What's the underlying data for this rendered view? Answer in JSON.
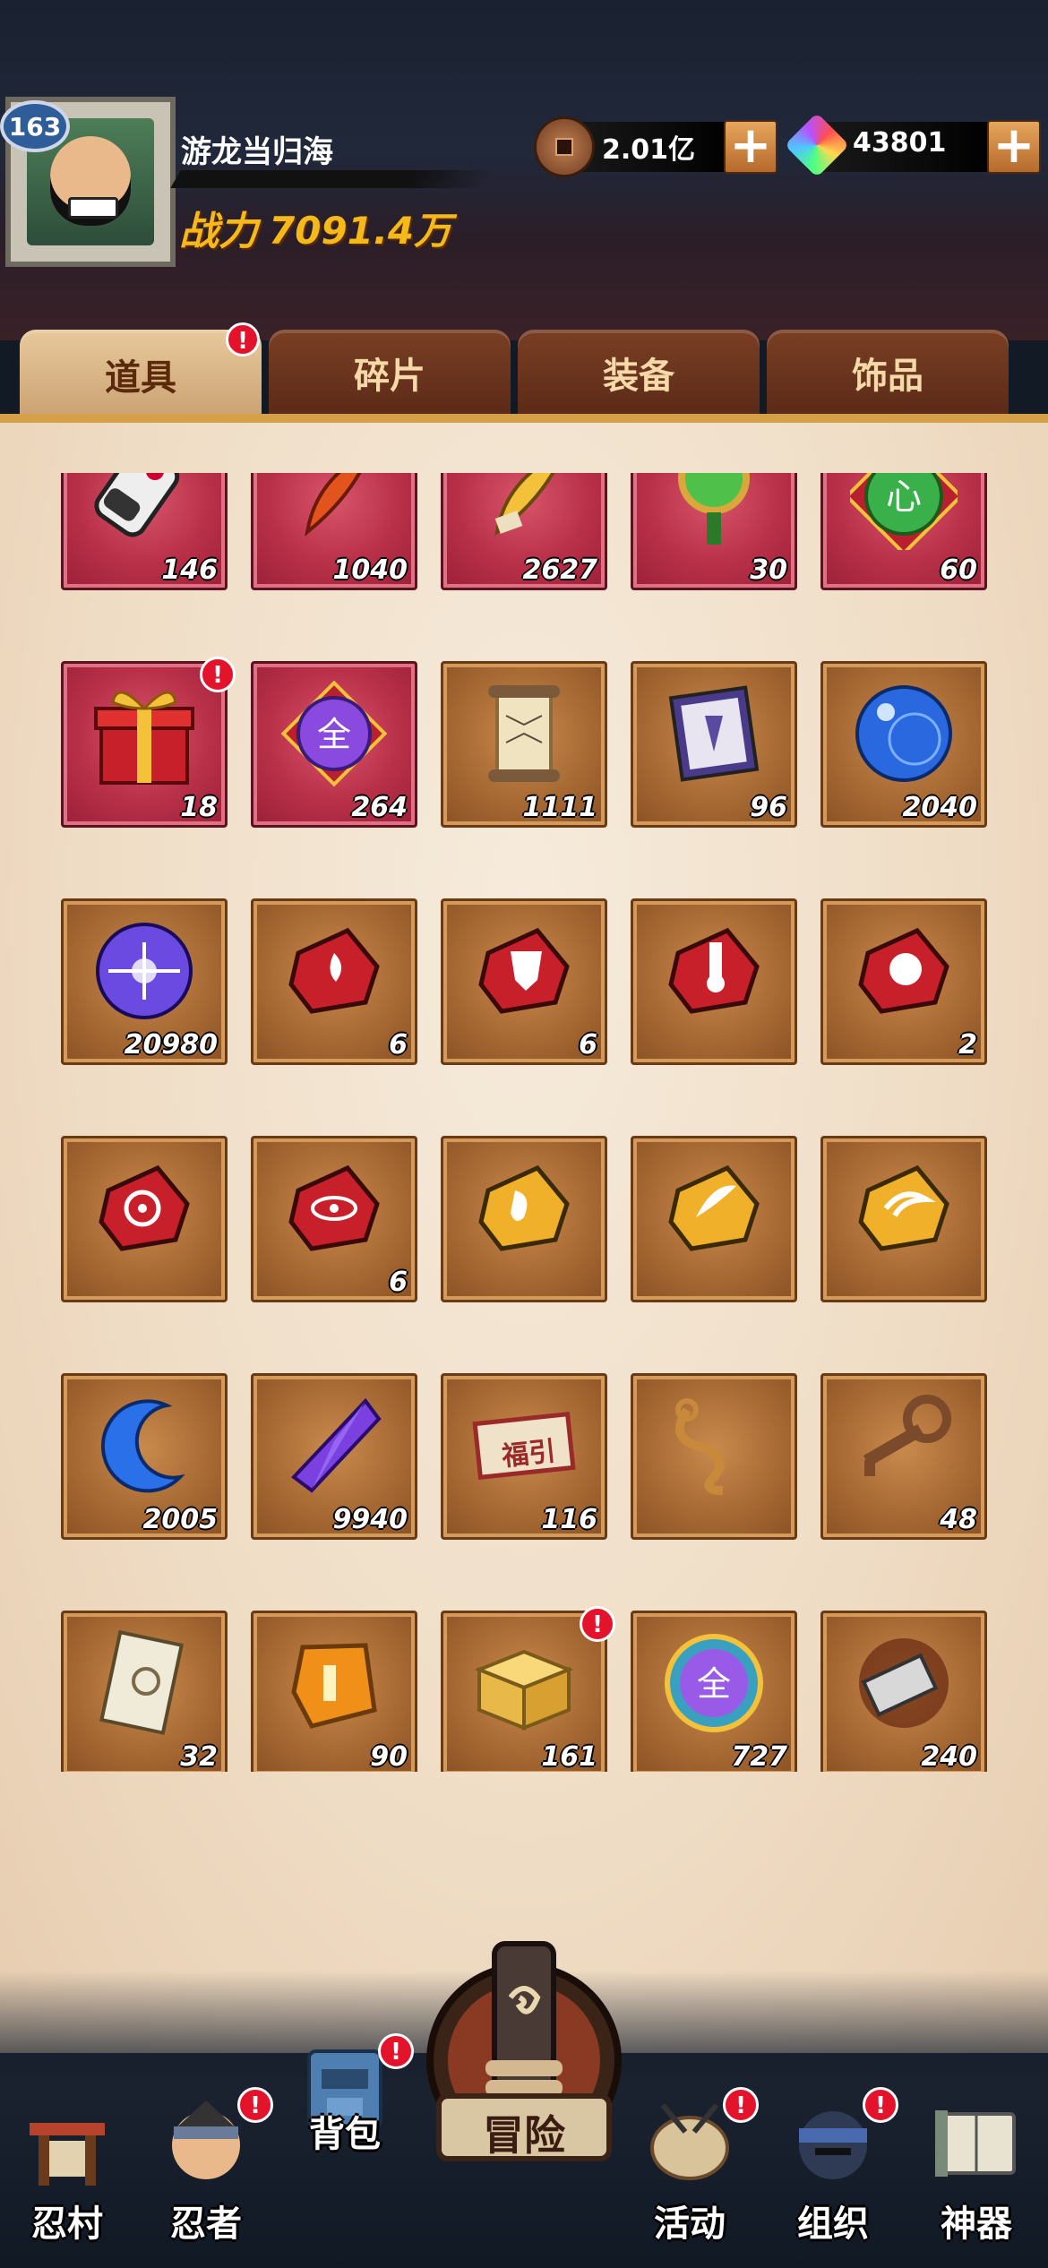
{
  "player": {
    "level": "163",
    "name": "游龙当归海",
    "power_label": "战力",
    "power_value": "7091.4万"
  },
  "currency": {
    "coins": "2.01亿",
    "gems": "43801",
    "add_label": "+"
  },
  "tabs": [
    {
      "label": "道具",
      "active": true,
      "alert": "!"
    },
    {
      "label": "碎片",
      "active": false
    },
    {
      "label": "装备",
      "active": false
    },
    {
      "label": "饰品",
      "active": false
    }
  ],
  "items": [
    {
      "icon": "scroll-bundle-icon",
      "count": "146",
      "frame": "red"
    },
    {
      "icon": "red-feather-icon",
      "count": "1040",
      "frame": "red"
    },
    {
      "icon": "gold-feather-icon",
      "count": "2627",
      "frame": "red"
    },
    {
      "icon": "jade-amulet-icon",
      "count": "30",
      "frame": "red"
    },
    {
      "icon": "green-heart-orb-icon",
      "count": "60",
      "frame": "red"
    },
    {
      "icon": "gift-box-icon",
      "count": "18",
      "frame": "red",
      "alert": "!"
    },
    {
      "icon": "all-orb-icon",
      "count": "264",
      "frame": "red"
    },
    {
      "icon": "map-scroll-icon",
      "count": "1111",
      "frame": "bronze"
    },
    {
      "icon": "exchange-card-icon",
      "count": "96",
      "frame": "bronze"
    },
    {
      "icon": "blue-orb-icon",
      "count": "2040",
      "frame": "bronze"
    },
    {
      "icon": "purple-orb-icon",
      "count": "20980",
      "frame": "bronze"
    },
    {
      "icon": "fire-stone-icon",
      "count": "6",
      "frame": "bronze"
    },
    {
      "icon": "shield-stone-icon",
      "count": "6",
      "frame": "bronze"
    },
    {
      "icon": "brush-stone-icon",
      "count": "",
      "frame": "bronze"
    },
    {
      "icon": "fist-stone-icon",
      "count": "2",
      "frame": "bronze"
    },
    {
      "icon": "target-stone-icon",
      "count": "",
      "frame": "bronze"
    },
    {
      "icon": "eye-stone-icon",
      "count": "6",
      "frame": "bronze"
    },
    {
      "icon": "gold-hand-stone-icon",
      "count": "",
      "frame": "bronze"
    },
    {
      "icon": "gold-flame-stone-icon",
      "count": "",
      "frame": "bronze"
    },
    {
      "icon": "gold-swirl-stone-icon",
      "count": "",
      "frame": "bronze"
    },
    {
      "icon": "blue-moon-icon",
      "count": "2005",
      "frame": "bronze"
    },
    {
      "icon": "purple-crystal-icon",
      "count": "9940",
      "frame": "bronze"
    },
    {
      "icon": "fortune-ticket-icon",
      "count": "116",
      "frame": "bronze",
      "label": "福引"
    },
    {
      "icon": "rope-icon",
      "count": "",
      "frame": "bronze"
    },
    {
      "icon": "bronze-key-icon",
      "count": "48",
      "frame": "bronze"
    },
    {
      "icon": "seal-paper-icon",
      "count": "32",
      "frame": "bronze"
    },
    {
      "icon": "amber-stone-icon",
      "count": "90",
      "frame": "bronze"
    },
    {
      "icon": "gold-box-icon",
      "count": "161",
      "frame": "bronze",
      "alert": "!"
    },
    {
      "icon": "all-medal-icon",
      "count": "727",
      "frame": "bronze"
    },
    {
      "icon": "shuriken-blade-icon",
      "count": "240",
      "frame": "bronze"
    }
  ],
  "nav": [
    {
      "label": "忍村",
      "icon": "village-gate-icon"
    },
    {
      "label": "忍者",
      "icon": "ninja-face-icon",
      "alert": "!"
    },
    {
      "label": "背包",
      "icon": "backpack-icon",
      "alert": "!"
    },
    {
      "label": "冒险",
      "icon": "adventure-scroll-icon"
    },
    {
      "label": "活动",
      "icon": "drum-icon",
      "alert": "!"
    },
    {
      "label": "组织",
      "icon": "team-face-icon",
      "alert": "!"
    },
    {
      "label": "神器",
      "icon": "artifact-book-icon"
    }
  ],
  "colors": {
    "accent": "#f6b91a",
    "alert": "#e3132b",
    "tab_active": "#e8c99c",
    "tab_inactive": "#6b3520"
  }
}
